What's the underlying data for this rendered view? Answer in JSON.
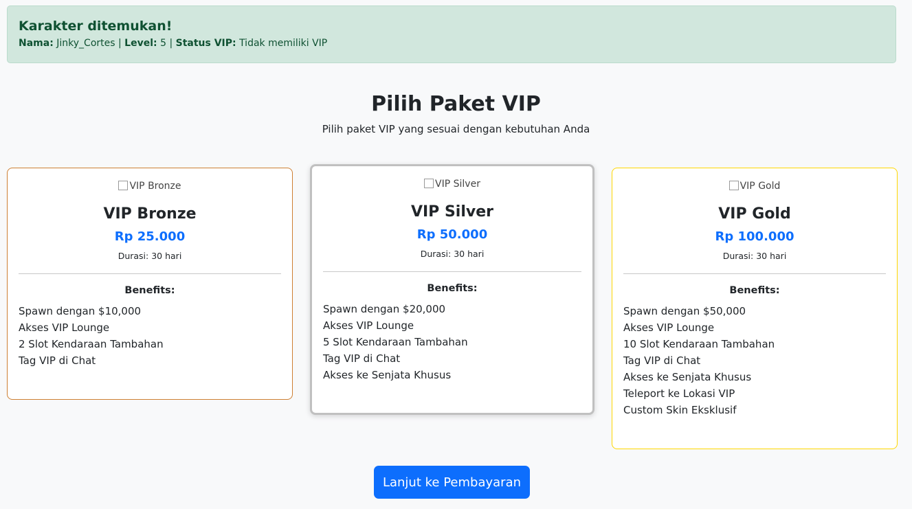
{
  "alert": {
    "title": "Karakter ditemukan!",
    "name_label": "Nama:",
    "name_value": "Jinky_Cortes",
    "separator1": "|",
    "level_label": "Level:",
    "level_value": "5",
    "separator2": "|",
    "vip_label": "Status VIP:",
    "vip_value": "Tidak memiliki VIP"
  },
  "heading": {
    "title": "Pilih Paket VIP",
    "subtitle": "Pilih paket VIP yang sesuai dengan kebutuhan Anda"
  },
  "packages": [
    {
      "img_alt": "VIP Bronze",
      "name": "VIP Bronze",
      "price": "Rp 25.000",
      "duration": "Durasi: 30 hari",
      "benefits_title": "Benefits:",
      "border_color": "#cd7f32",
      "benefits": [
        "Spawn dengan $10,000",
        "Akses VIP Lounge",
        "2 Slot Kendaraan Tambahan",
        "Tag VIP di Chat"
      ]
    },
    {
      "img_alt": "VIP Silver",
      "name": "VIP Silver",
      "price": "Rp 50.000",
      "duration": "Durasi: 30 hari",
      "benefits_title": "Benefits:",
      "border_color": "#c0c0c0",
      "selected": true,
      "benefits": [
        "Spawn dengan $20,000",
        "Akses VIP Lounge",
        "5 Slot Kendaraan Tambahan",
        "Tag VIP di Chat",
        "Akses ke Senjata Khusus"
      ]
    },
    {
      "img_alt": "VIP Gold",
      "name": "VIP Gold",
      "price": "Rp 100.000",
      "duration": "Durasi: 30 hari",
      "benefits_title": "Benefits:",
      "border_color": "#ffd700",
      "benefits": [
        "Spawn dengan $50,000",
        "Akses VIP Lounge",
        "10 Slot Kendaraan Tambahan",
        "Tag VIP di Chat",
        "Akses ke Senjata Khusus",
        "Teleport ke Lokasi VIP",
        "Custom Skin Eksklusif"
      ]
    }
  ],
  "actions": {
    "continue_label": "Lanjut ke Pembayaran"
  },
  "colors": {
    "primary": "#0d6efd",
    "success_bg": "#d1e7dd",
    "success_text": "#0f5132"
  }
}
